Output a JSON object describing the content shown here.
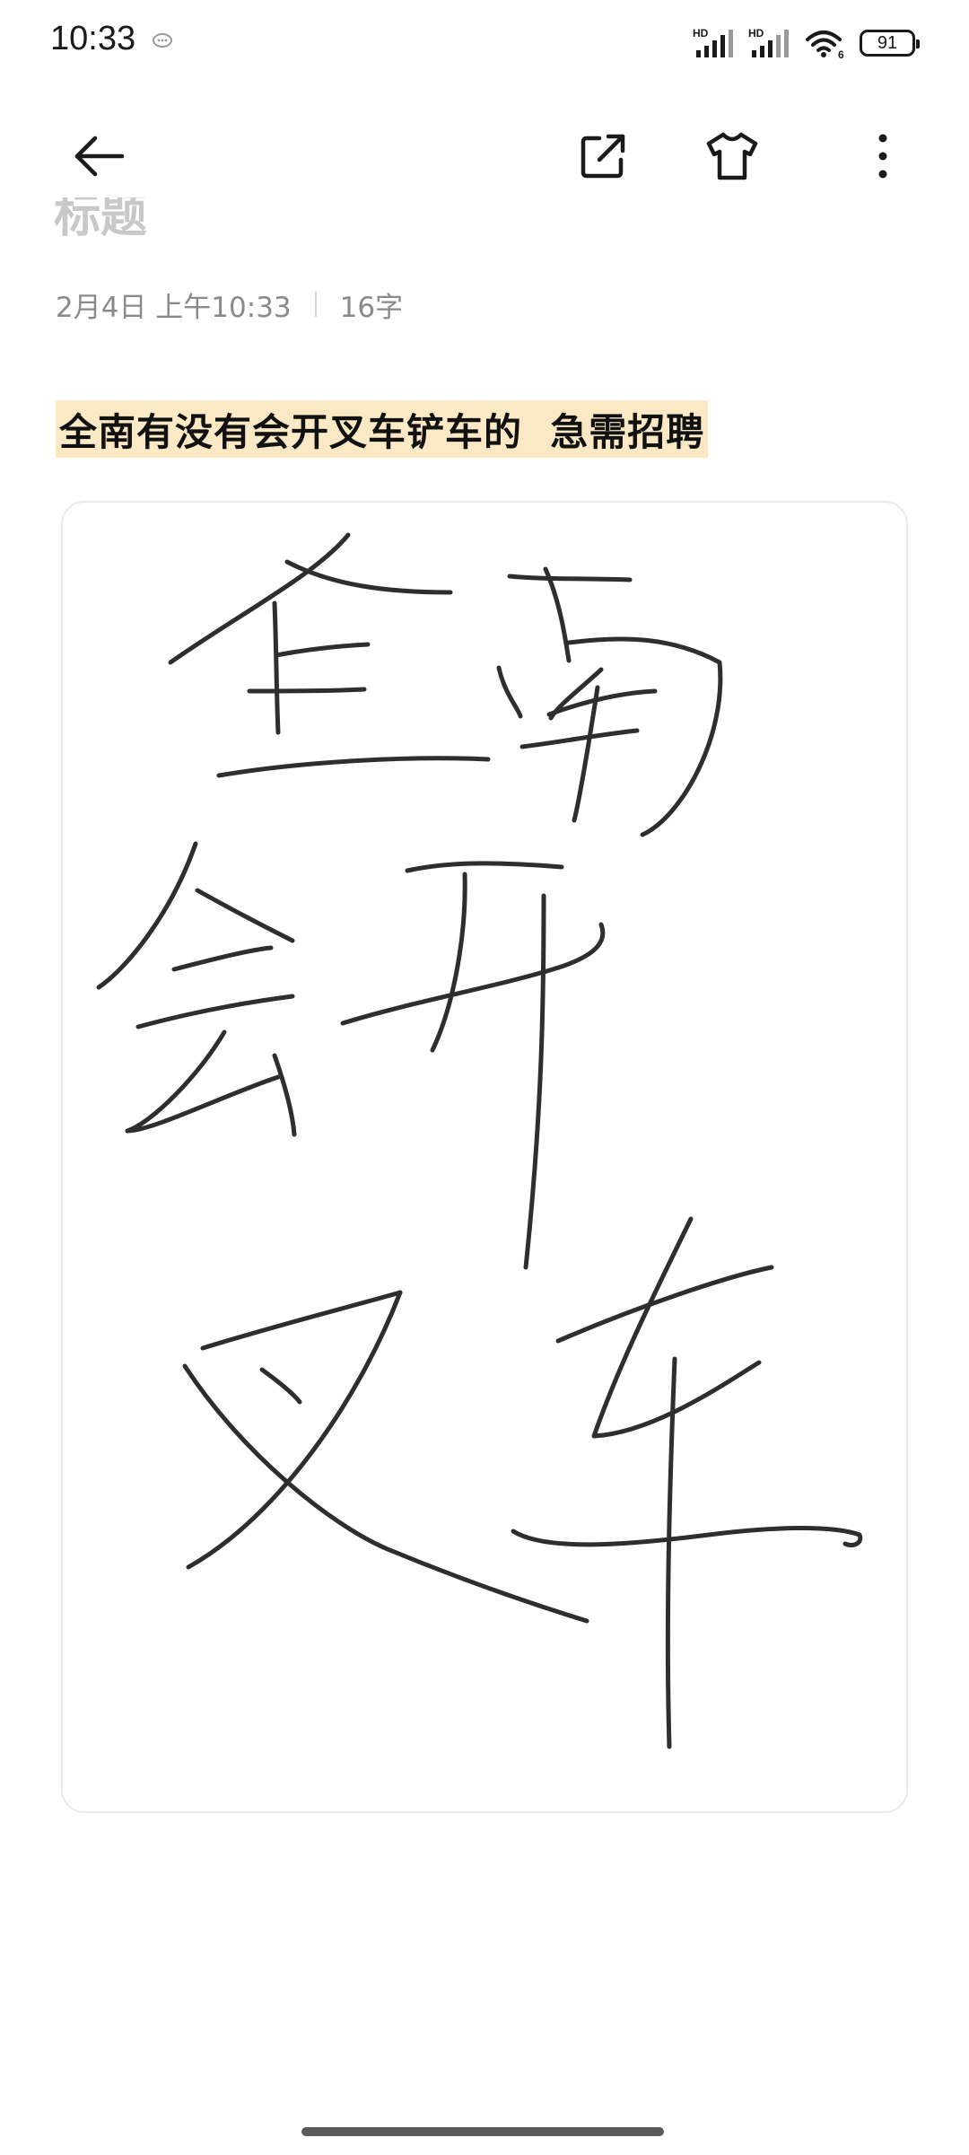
{
  "status_bar": {
    "time": "10:33",
    "signal1_tag": "HD",
    "signal2_tag": "HD",
    "wifi_tag": "6",
    "battery": "91"
  },
  "toolbar": {
    "icons": [
      "back-arrow-icon",
      "share-export-icon",
      "theme-shirt-icon",
      "more-vertical-icon"
    ]
  },
  "note": {
    "title": "标题",
    "date": "2月4日 上午10:33",
    "word_count": "16字",
    "first_line": "全南有没有会开叉车铲车的  急需招聘",
    "handwriting_alt": "全南会开叉车"
  },
  "colors": {
    "highlight": "#fbe8c4",
    "ink": "#2b2b2b",
    "meta_text": "#8a8a8a"
  }
}
